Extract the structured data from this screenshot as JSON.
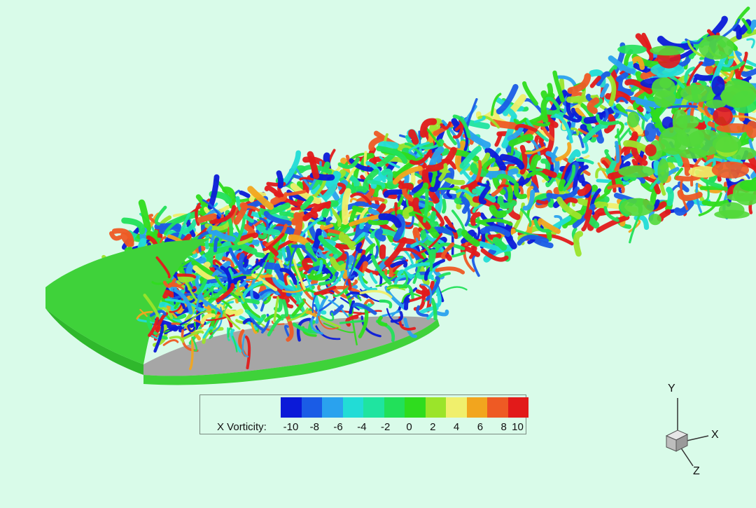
{
  "legend": {
    "title": "X Vorticity:",
    "ticks": [
      "-10",
      "-8",
      "-6",
      "-4",
      "-2",
      "0",
      "2",
      "4",
      "6",
      "8",
      "10"
    ],
    "colors": [
      "#0b1ad8",
      "#1a5ce6",
      "#2aa2ee",
      "#22dcd6",
      "#1fe4a0",
      "#22e05a",
      "#2fdc1e",
      "#9be42a",
      "#f0ef6c",
      "#f2a51e",
      "#ee5a24",
      "#e21a1a"
    ]
  },
  "axes": {
    "y": "Y",
    "x": "X",
    "z": "Z"
  },
  "palette": {
    "background": "#d9fbe9",
    "wing_top": "#3fd23a",
    "wing_section": "#a6a6a6"
  }
}
